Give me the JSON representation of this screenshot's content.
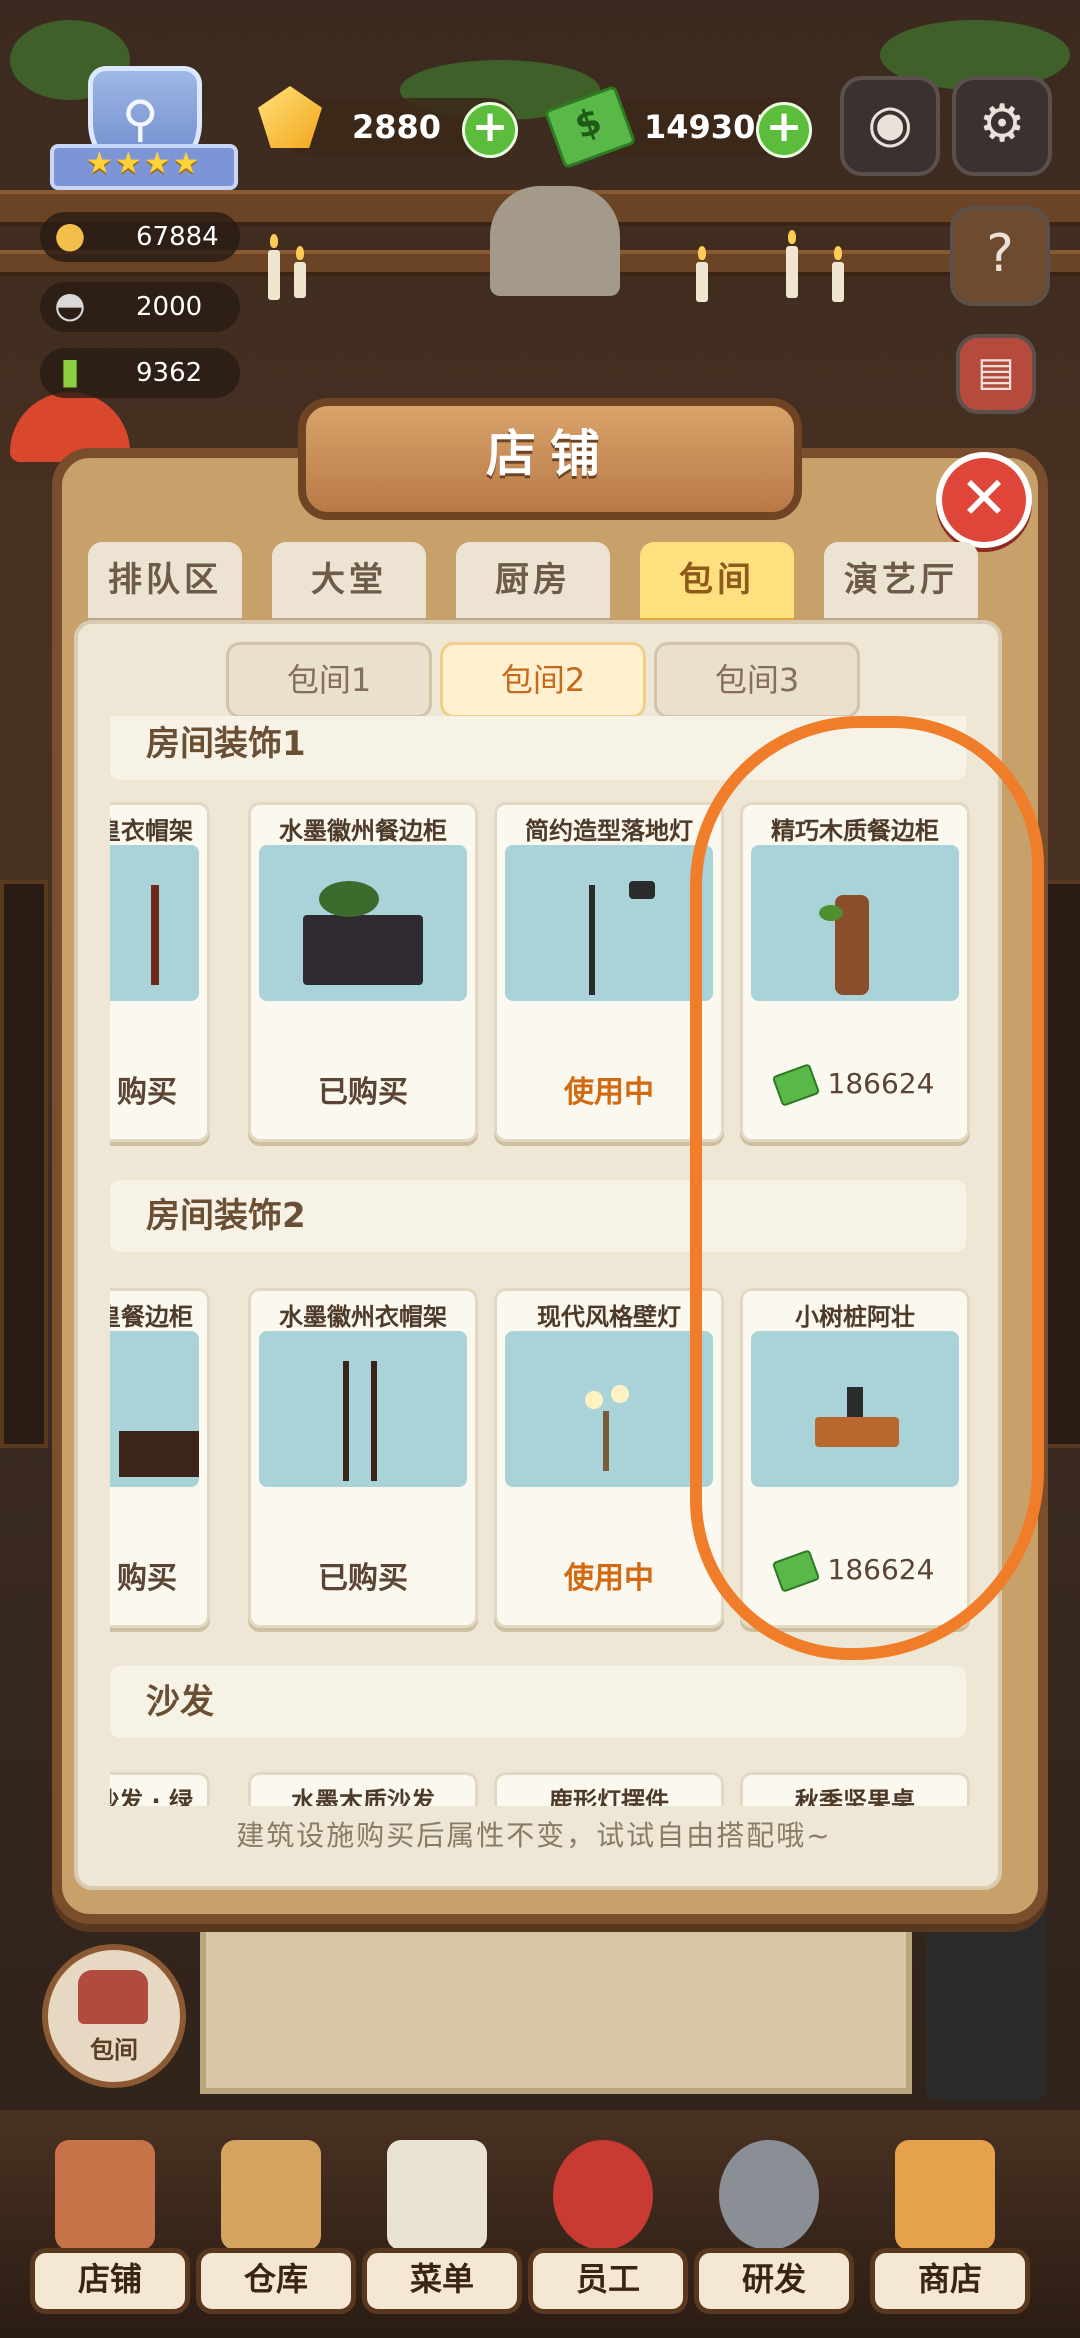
{
  "hud": {
    "gems": "2880",
    "cash": "149305",
    "stats": [
      "67884",
      "2000",
      "9362"
    ]
  },
  "panel": {
    "title": "店铺",
    "tabs": [
      "排队区",
      "大堂",
      "厨房",
      "包间",
      "演艺厅"
    ],
    "active_tab": "包间",
    "subtabs": [
      "包间1",
      "包间2",
      "包间3"
    ],
    "active_subtab": "包间2",
    "sections": [
      {
        "title": "房间装饰1",
        "items": [
          {
            "name": "皇衣帽架",
            "status": "购买"
          },
          {
            "name": "水墨徽州餐边柜",
            "status": "已购买"
          },
          {
            "name": "简约造型落地灯",
            "status": "使用中"
          },
          {
            "name": "精巧木质餐边柜",
            "price": "186624"
          }
        ]
      },
      {
        "title": "房间装饰2",
        "items": [
          {
            "name": "皇餐边柜",
            "status": "购买"
          },
          {
            "name": "水墨徽州衣帽架",
            "status": "已购买"
          },
          {
            "name": "现代风格壁灯",
            "status": "使用中"
          },
          {
            "name": "小树桩阿壮",
            "price": "186624"
          }
        ]
      },
      {
        "title": "沙发",
        "items": [
          {
            "name": "沙发 · 绿"
          },
          {
            "name": "水墨木质沙发"
          },
          {
            "name": "鹿形灯摆件"
          },
          {
            "name": "秋季坚果桌"
          }
        ]
      }
    ],
    "hint": "建筑设施购买后属性不变，试试自由搭配哦~"
  },
  "side_button": {
    "label": "包间"
  },
  "nav": [
    "店铺",
    "仓库",
    "菜单",
    "员工",
    "研发",
    "商店"
  ],
  "colors": {
    "accent": "#f07d2a",
    "active_tab": "#ffe07f",
    "using": "#d26a12",
    "plus": "#5bbd3b",
    "close": "#e0453a"
  }
}
